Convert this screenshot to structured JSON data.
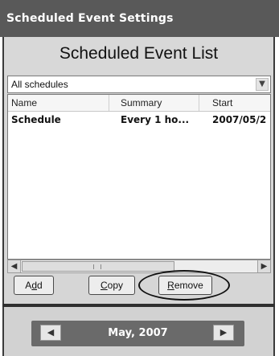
{
  "window": {
    "title": "Scheduled Event Settings"
  },
  "panel": {
    "heading": "Scheduled Event List"
  },
  "filter": {
    "selected": "All schedules",
    "arrow_icon": "chevron-down-icon"
  },
  "list": {
    "columns": [
      "Name",
      "Summary",
      "Start"
    ],
    "rows": [
      [
        "Schedule",
        "Every 1 ho...",
        "2007/05/2"
      ]
    ]
  },
  "scrollbar": {
    "left_icon": "arrow-left-icon",
    "right_icon": "arrow-right-icon"
  },
  "buttons": {
    "add": {
      "pre": "A",
      "mnemonic": "d",
      "post": "d"
    },
    "copy": {
      "pre": "",
      "mnemonic": "C",
      "post": "opy"
    },
    "remove": {
      "pre": "",
      "mnemonic": "R",
      "post": "emove"
    }
  },
  "navigation": {
    "month": "May, 2007",
    "prev_icon": "arrow-left-icon",
    "next_icon": "arrow-right-icon"
  },
  "colors": {
    "titlebar": "#595959",
    "panel": "#d6d6d6",
    "nav_bar": "#6a6a6a",
    "annotation": "#111111"
  }
}
